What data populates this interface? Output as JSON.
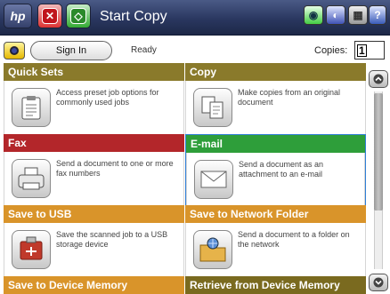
{
  "header": {
    "home_icon": "hp-logo-icon",
    "title": "Start Copy"
  },
  "status": {
    "sign_in_label": "Sign In",
    "status_text": "Ready",
    "copies_label": "Copies:",
    "copies_value": "1"
  },
  "tiles": [
    {
      "title": "Quick Sets",
      "desc": "Access preset job options for commonly used jobs",
      "color": "#8a7a2b",
      "icon": "clipboard-icon"
    },
    {
      "title": "Copy",
      "desc": "Make copies from an original document",
      "color": "#8a7a2b",
      "icon": "copy-pages-icon"
    },
    {
      "title": "Fax",
      "desc": "Send a document to one or more fax numbers",
      "color": "#b3262a",
      "icon": "fax-icon"
    },
    {
      "title": "E-mail",
      "desc": "Send a document as an attachment to an e-mail",
      "color": "#2e9e3a",
      "icon": "envelope-icon"
    },
    {
      "title": "Save to USB",
      "desc": "Save the scanned job to a USB storage device",
      "color": "#d9942a",
      "icon": "usb-icon"
    },
    {
      "title": "Save to Network Folder",
      "desc": "Send a document to a folder on the network",
      "color": "#d9942a",
      "icon": "network-folder-icon"
    },
    {
      "title": "Save to Device Memory",
      "color": "#d9942a"
    },
    {
      "title": "Retrieve from Device Memory",
      "color": "#7a6a1f"
    }
  ]
}
